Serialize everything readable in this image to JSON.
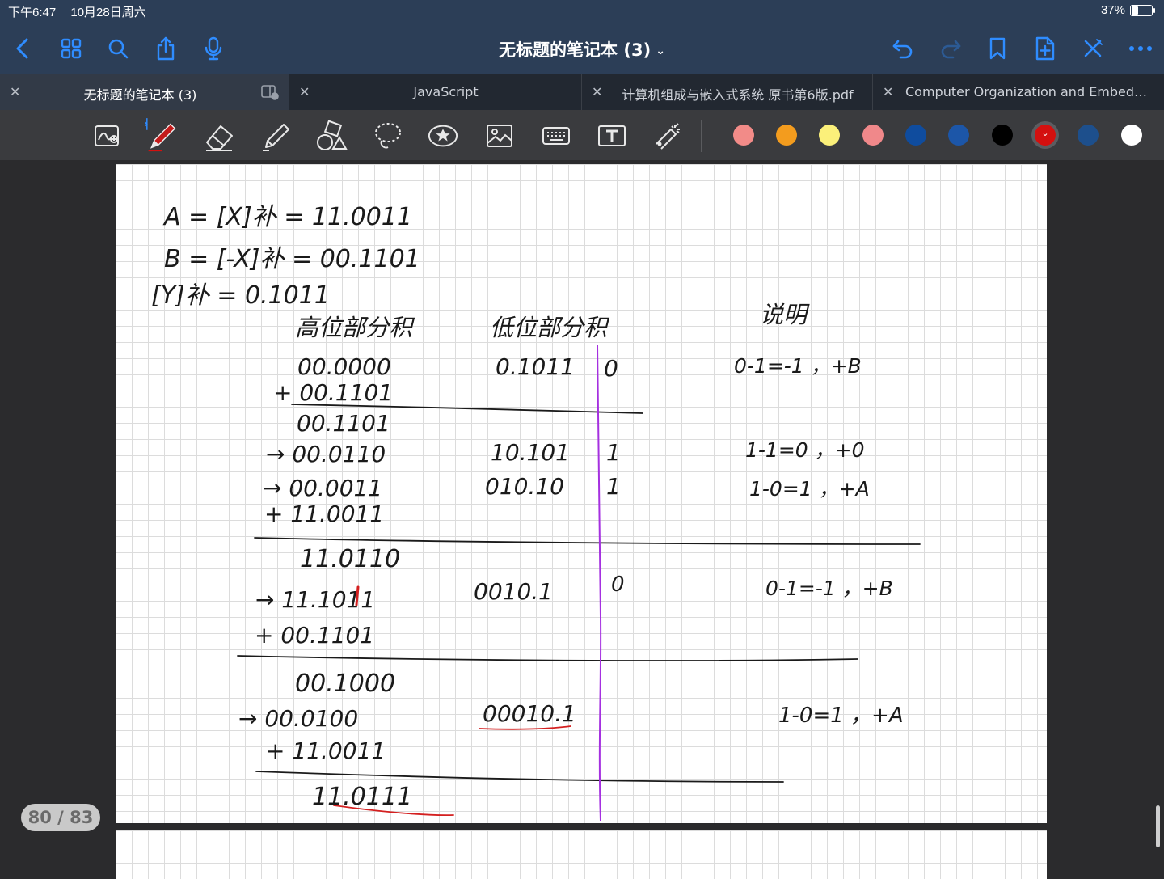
{
  "status": {
    "time": "下午6:47",
    "date": "10月28日周六",
    "battery": "37%"
  },
  "nav": {
    "title": "无标题的笔记本 (3)",
    "chevron": "⌄"
  },
  "tabs": [
    {
      "label": "无标题的笔记本 (3)",
      "active": true
    },
    {
      "label": "JavaScript",
      "active": false
    },
    {
      "label": "计算机组成与嵌入式系统  原书第6版.pdf",
      "active": false
    },
    {
      "label": "Computer Organization and Embedded Systems",
      "active": false
    }
  ],
  "tools": [
    "lasso-zoom-icon",
    "pen-icon",
    "eraser-icon",
    "highlighter-icon",
    "shapes-icon",
    "lasso-icon",
    "sticker-icon",
    "image-icon",
    "keyboard-icon",
    "text-icon",
    "laser-pointer-icon"
  ],
  "colors": [
    "#f28b88",
    "#f39c1e",
    "#fbf07a",
    "#f0888a",
    "#0f4c9e",
    "#1c56a8",
    "#000000",
    "#d4100f",
    "#1d4f8c",
    "#ffffff"
  ],
  "selected_color": "#d4100f",
  "page_counter": "80 / 83",
  "note": {
    "line_a": "A = [X]补 = 11.0011",
    "line_b": "B = [-X]补 = 00.1101",
    "line_y": "[Y]补 = 0.1011",
    "header_high": "高位部分积",
    "header_low": "低位部分积",
    "header_desc": "说明",
    "r1_high": "00.0000",
    "r1_low": "0.1011",
    "r1_bit": "0",
    "r1_desc": "0-1=-1 ，+B",
    "r2_high": "+ 00.1101",
    "r3_high": "00.1101",
    "r4_high": "→ 00.0110",
    "r4_low": "10.101",
    "r4_bit": "1",
    "r4_desc": "1-1=0 ，+0",
    "r5_high": "→ 00.0011",
    "r5_low": "010.10",
    "r5_bit": "1",
    "r5_desc": "1-0=1 ，+A",
    "r6_high": "+ 11.0011",
    "r7_high": "11.0110",
    "r8_high": "→ 11.1011",
    "r8_low": "0010.1",
    "r8_bit": "0",
    "r8_desc": "0-1=-1 ，+B",
    "r9_high": "+ 00.1101",
    "r10_high": "00.1000",
    "r11_high": "→ 00.0100",
    "r11_low": "00010.1",
    "r11_desc": "1-0=1 ，+A",
    "r12_high": "+ 11.0011",
    "r13_high": "11.0111"
  }
}
